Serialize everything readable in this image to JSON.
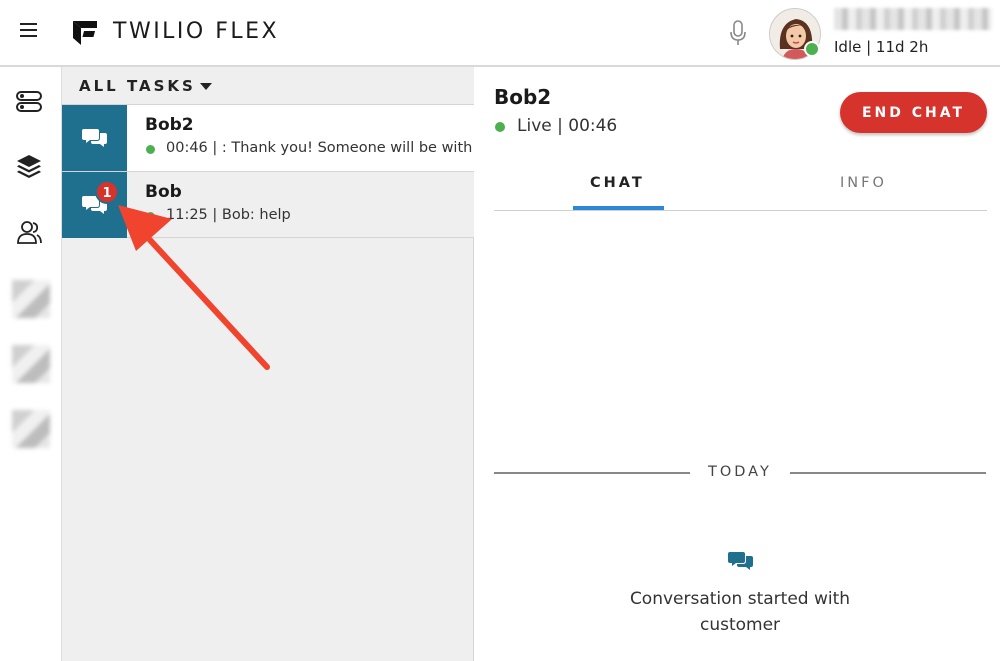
{
  "header": {
    "brand": "TWILIO FLEX",
    "activity": "Idle | 11d 2h"
  },
  "tasklist": {
    "title": "ALL TASKS",
    "tasks": [
      {
        "name": "Bob2",
        "line": "00:46 | : Thank you! Someone will be with",
        "badge": ""
      },
      {
        "name": "Bob",
        "line": "11:25 | Bob: help",
        "badge": "1"
      }
    ]
  },
  "chat": {
    "customer_name": "Bob2",
    "status": "Live | 00:46",
    "end_chat_label": "END CHAT",
    "tabs": [
      "CHAT",
      "INFO"
    ],
    "active_tab": "CHAT",
    "day_divider": "TODAY",
    "system_message": "Conversation started with customer"
  },
  "colors": {
    "task_icon_bg": "#1f6f8f",
    "accent_red": "#d6332d",
    "live_green": "#4caf50",
    "tab_underline": "#2f86d6",
    "tasklist_bg": "#efefef",
    "annotation_arrow": "#f0442e"
  },
  "icons": {
    "menu": "hamburger-icon",
    "logo": "twilio-flex-logo",
    "mic": "microphone-icon",
    "nav": [
      "toggles-icon",
      "layers-icon",
      "agents-icon"
    ],
    "task": "chat-bubbles-icon"
  }
}
